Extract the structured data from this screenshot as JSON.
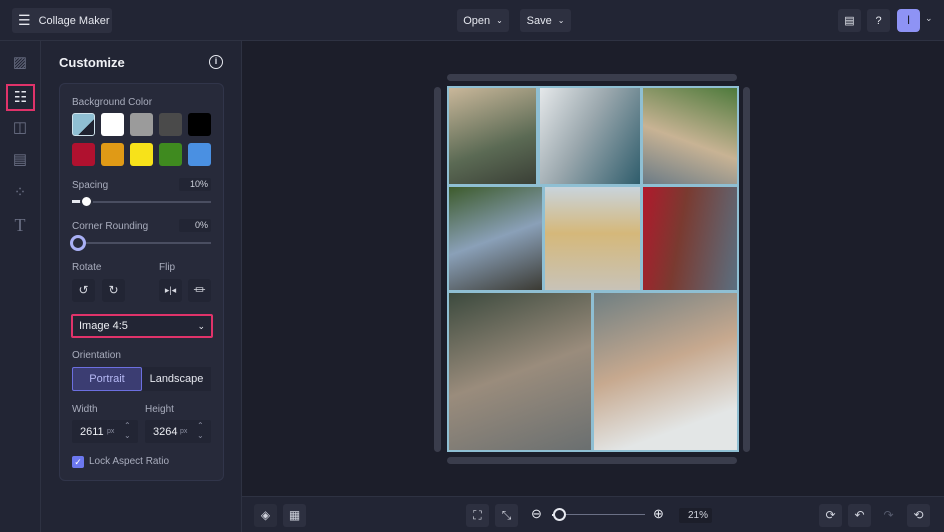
{
  "app": {
    "title": "Collage Maker",
    "menu_open": "Open",
    "menu_save": "Save",
    "avatar_initial": "I"
  },
  "panel": {
    "title": "Customize",
    "background_color_label": "Background Color",
    "colors": [
      "#8fbfd3",
      "#ffffff",
      "#9b9b9b",
      "#4a4a4a",
      "#000000",
      "#b0112f",
      "#e09a16",
      "#f7e21a",
      "#3f8a1f",
      "#4a90e2"
    ],
    "spacing_label": "Spacing",
    "spacing_value": "10%",
    "spacing_fraction": 0.1,
    "corner_label": "Corner Rounding",
    "corner_value": "0%",
    "corner_fraction": 0,
    "rotate_label": "Rotate",
    "flip_label": "Flip",
    "size_preset": "Image 4:5",
    "orientation_label": "Orientation",
    "portrait": "Portrait",
    "landscape": "Landscape",
    "width_label": "Width",
    "height_label": "Height",
    "width_value": "2611",
    "height_value": "3264",
    "unit": "px",
    "lock_label": "Lock Aspect Ratio",
    "lock_checked": true
  },
  "bottom": {
    "zoom_value": "21%",
    "zoom_fraction": 0.07
  },
  "colors": {
    "accent": "#6c6fe0",
    "highlight": "#e0336a",
    "frame": "#8fbfd3"
  }
}
